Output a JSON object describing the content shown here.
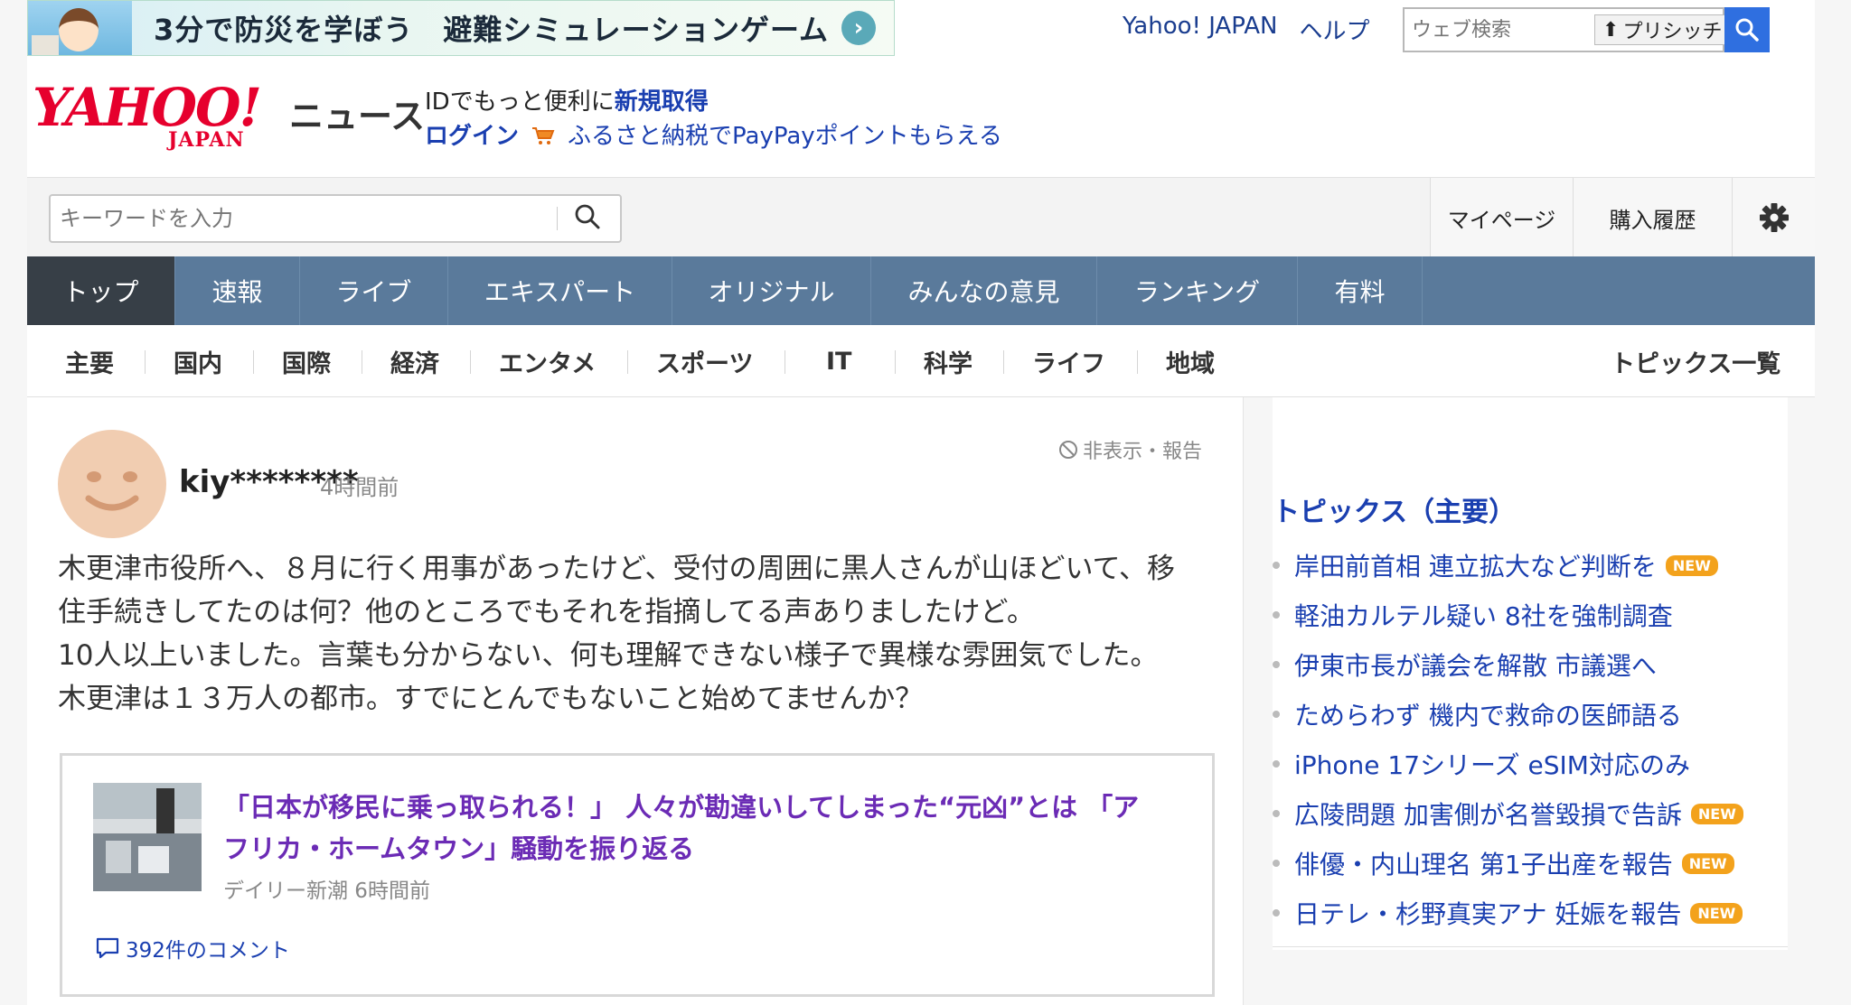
{
  "banner": {
    "text": "3分で防災を学ぼう　避難シミュレーションゲーム"
  },
  "toplinks": {
    "yahoo_japan": "Yahoo! JAPAN",
    "help": "ヘルプ"
  },
  "websearch": {
    "placeholder": "ウェブ検索",
    "purush": "プリシッチ"
  },
  "logo": {
    "yahoo": "YAHOO!",
    "japan": "JAPAN",
    "news": "ニュース"
  },
  "account": {
    "id_prefix": "IDでもっと便利に",
    "register": "新規取得",
    "login": "ログイン",
    "furusato": "ふるさと納税でPayPayポイントもらえる"
  },
  "search": {
    "placeholder": "キーワードを入力"
  },
  "rightlinks": {
    "mypage": "マイページ",
    "history": "購入履歴"
  },
  "mainnav": [
    "トップ",
    "速報",
    "ライブ",
    "エキスパート",
    "オリジナル",
    "みんなの意見",
    "ランキング",
    "有料"
  ],
  "subnav": [
    "主要",
    "国内",
    "国際",
    "経済",
    "エンタメ",
    "スポーツ",
    "IT",
    "科学",
    "ライフ",
    "地域"
  ],
  "subnav_right": "トピックス一覧",
  "comment": {
    "user": "kiy********",
    "time": "4時間前",
    "hide_report": "非表示・報告",
    "lines": [
      "木更津市役所へ、８月に行く用事があったけど、受付の周囲に黒人さんが山ほどいて、移",
      "住手続きしてたのは何？他のところでもそれを指摘してる声ありましたけど。",
      "10人以上いました。言葉も分からない、何も理解できない様子で異様な雰囲気でした。",
      "木更津は１３万人の都市。すでにとんでもないこと始めてませんか？"
    ]
  },
  "article": {
    "title_line1": "「日本が移民に乗っ取られる！」 人々が勘違いしてしまった“元凶”とは 「ア",
    "title_line2": "フリカ・ホームタウン」騒動を振り返る",
    "source": "デイリー新潮 6時間前",
    "comments": "392件のコメント"
  },
  "topics": {
    "title": "トピックス（主要）",
    "new_label": "NEW",
    "items": [
      {
        "text": "岸田前首相 連立拡大など判断を",
        "new": true
      },
      {
        "text": "軽油カルテル疑い 8社を強制調査",
        "new": false
      },
      {
        "text": "伊東市長が議会を解散 市議選へ",
        "new": false
      },
      {
        "text": "ためらわず 機内で救命の医師語る",
        "new": false
      },
      {
        "text": "iPhone 17シリーズ eSIM対応のみ",
        "new": false
      },
      {
        "text": "広陵問題 加害側が名誉毀損で告訴",
        "new": true
      },
      {
        "text": "俳優・内山理名 第1子出産を報告",
        "new": true
      },
      {
        "text": "日テレ・杉野真実アナ 妊娠を報告",
        "new": true
      }
    ]
  },
  "colors": {
    "nav_bg": "#5a7a9b",
    "nav_active": "#373f47",
    "link": "#1a3fb0",
    "article_title": "#6b2bb5",
    "new_badge": "#f3a21c"
  }
}
